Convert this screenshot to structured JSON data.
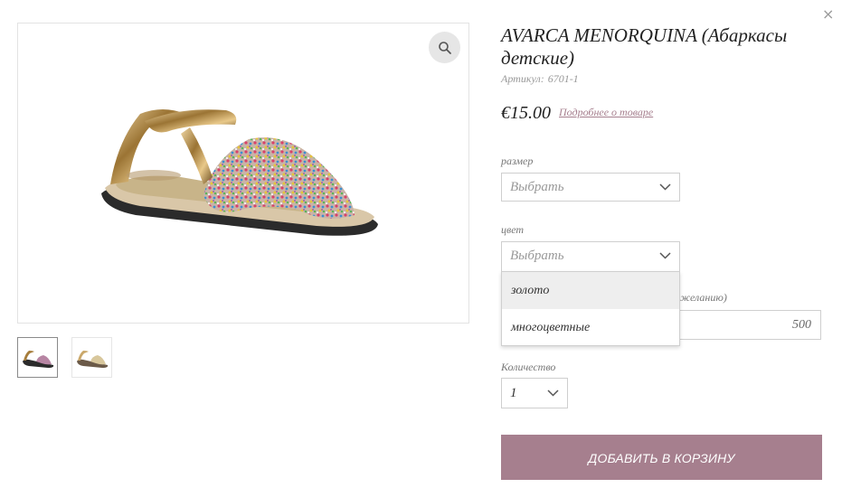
{
  "modal": {
    "close_label": "×"
  },
  "gallery": {
    "zoom_icon": "magnifier-icon",
    "thumbnails": [
      "glitter-sandal-thumb",
      "gold-sandal-thumb"
    ]
  },
  "product": {
    "title": "AVARCA MENORQUINA (Абаркасы детские)",
    "sku_label": "Артикул:",
    "sku_value": "6701-1",
    "price": "€15.00",
    "more_link": "Подробнее о товаре"
  },
  "options": {
    "size": {
      "label": "размер",
      "value": "Выбрать"
    },
    "color": {
      "label": "цвет",
      "value": "Выбрать",
      "dropdown": [
        "золото",
        "многоцветные"
      ],
      "highlighted_index": 0
    },
    "custom": {
      "label_partial": "желанию)",
      "value": "500"
    },
    "quantity": {
      "label": "Количество",
      "value": "1"
    }
  },
  "actions": {
    "add_to_cart": "ДОБАВИТЬ В КОРЗИНУ"
  },
  "colors": {
    "accent": "#a67f8e",
    "highlight": "#eeeeee",
    "border": "#cfcfcf"
  }
}
